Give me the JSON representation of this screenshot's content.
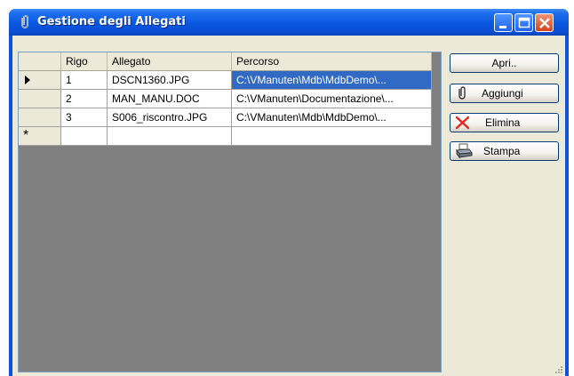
{
  "window": {
    "title": "Gestione degli Allegati"
  },
  "grid": {
    "columns": [
      "Rigo",
      "Allegato",
      "Percorso"
    ],
    "rows": [
      {
        "rigo": "1",
        "allegato": "DSCN1360.JPG",
        "percorso": "C:\\VManuten\\Mdb\\MdbDemo\\..."
      },
      {
        "rigo": "2",
        "allegato": "MAN_MANU.DOC",
        "percorso": "C:\\VManuten\\Documentazione\\..."
      },
      {
        "rigo": "3",
        "allegato": "S006_riscontro.JPG",
        "percorso": "C:\\VManuten\\Mdb\\MdbDemo\\..."
      }
    ],
    "new_row_marker": "*",
    "selection_color": "#316ac5"
  },
  "buttons": {
    "apri": "Apri..",
    "aggiungi": "Aggiungi",
    "elimina": "Elimina",
    "stampa": "Stampa"
  },
  "icons": {
    "title": "paperclip-icon",
    "aggiungi": "paperclip-icon",
    "elimina": "red-x-icon",
    "stampa": "printer-icon"
  }
}
